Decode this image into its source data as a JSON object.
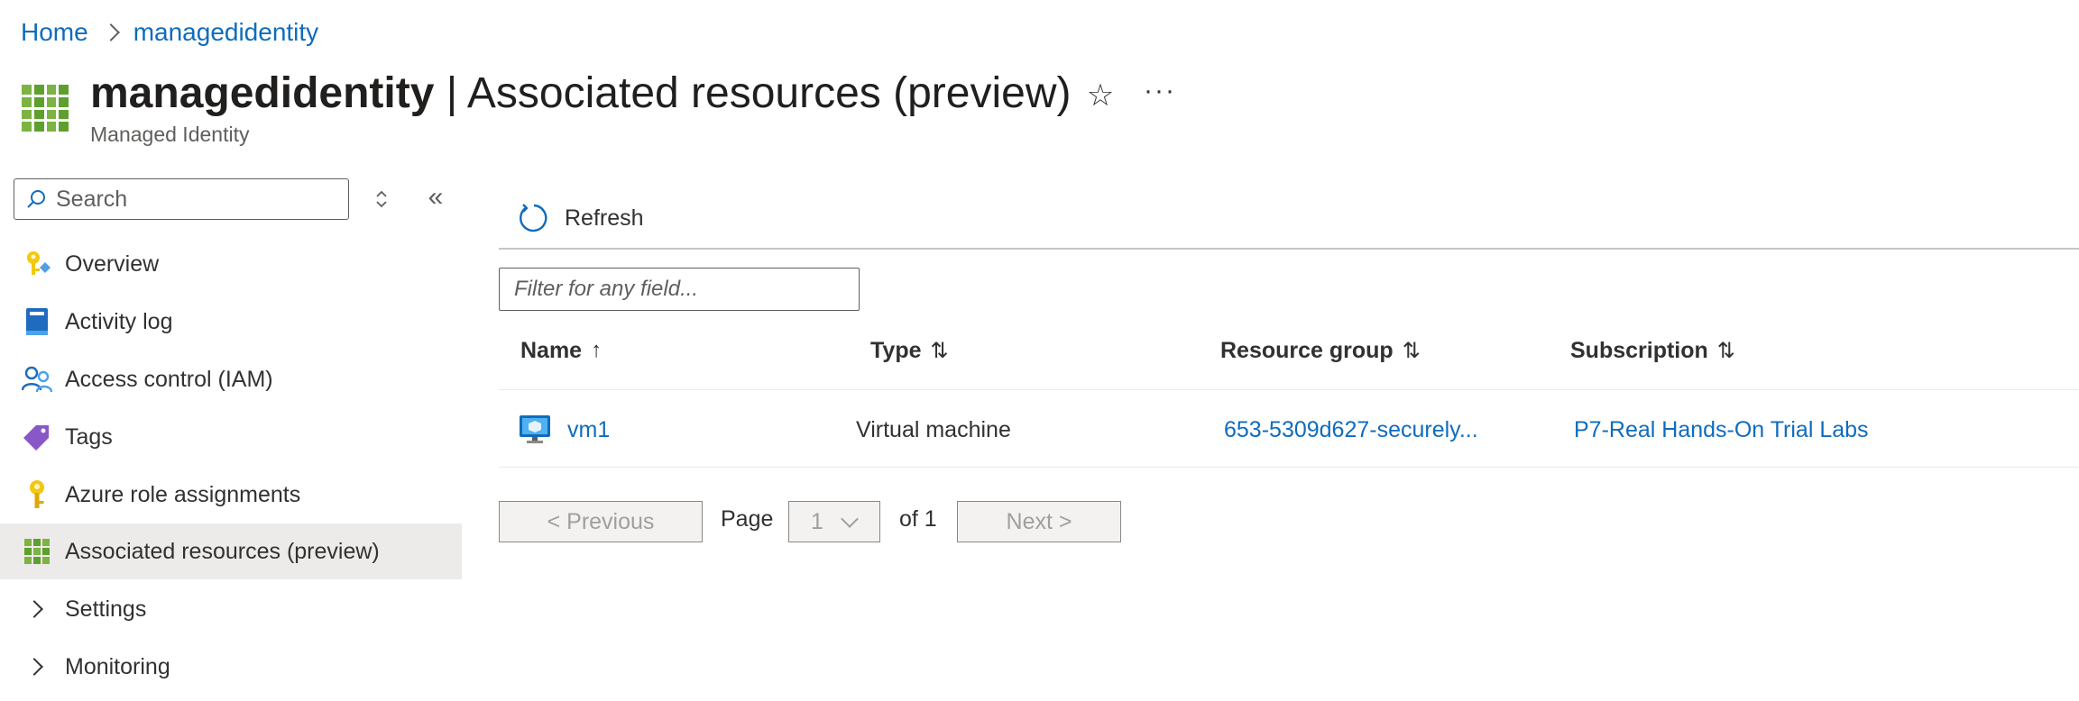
{
  "breadcrumb": {
    "home": "Home",
    "current": "managedidentity"
  },
  "header": {
    "resource_name": "managedidentity",
    "separator": " | ",
    "page_title": "Associated resources (preview)",
    "subtitle": "Managed Identity",
    "favorite_icon": "star-icon",
    "more_icon": "ellipsis-icon",
    "more_label": "···"
  },
  "sidebar": {
    "search_placeholder": "Search",
    "collapse_label": "«",
    "items": [
      {
        "label": "Overview",
        "icon": "key-badge-icon"
      },
      {
        "label": "Activity log",
        "icon": "activity-log-icon"
      },
      {
        "label": "Access control (IAM)",
        "icon": "people-icon"
      },
      {
        "label": "Tags",
        "icon": "tag-icon"
      },
      {
        "label": "Azure role assignments",
        "icon": "key-icon"
      },
      {
        "label": "Associated resources (preview)",
        "icon": "grid-icon",
        "active": true
      },
      {
        "label": "Settings",
        "icon": "chevron-right-icon"
      },
      {
        "label": "Monitoring",
        "icon": "chevron-right-icon"
      }
    ]
  },
  "toolbar": {
    "refresh_label": "Refresh"
  },
  "filter": {
    "placeholder": "Filter for any field..."
  },
  "table": {
    "columns": [
      {
        "label": "Name",
        "sort": "↑"
      },
      {
        "label": "Type",
        "sort": "⇅"
      },
      {
        "label": "Resource group",
        "sort": "⇅"
      },
      {
        "label": "Subscription",
        "sort": "⇅"
      }
    ],
    "rows": [
      {
        "name": "vm1",
        "type": "Virtual machine",
        "resource_group": "653-5309d627-securely...",
        "subscription": "P7-Real Hands-On Trial Labs"
      }
    ]
  },
  "pagination": {
    "previous_label": "< Previous",
    "page_label": "Page",
    "current_page": "1",
    "of_label": "of 1",
    "next_label": "Next >"
  },
  "colors": {
    "accent": "#0f6cbd",
    "active_bg": "#edebe9",
    "brand_green": "#5ea02d"
  }
}
